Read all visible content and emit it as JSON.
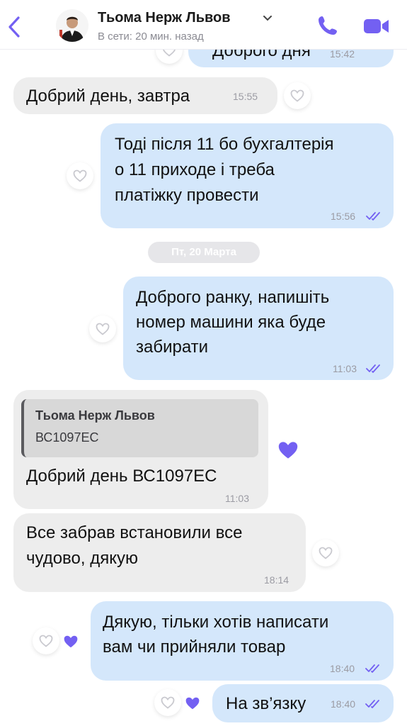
{
  "header": {
    "contact_name": "Тьома Нерж Львов",
    "status": "В сети: 20 мин. назад",
    "back_icon": "chevron-left-icon",
    "call_icon": "phone-icon",
    "video_icon": "video-camera-icon",
    "accent_color": "#7360f2"
  },
  "messages": [
    {
      "id": "m0",
      "direction": "out",
      "text": "Доброго дня",
      "time": "15:42",
      "partial": true
    },
    {
      "id": "m1",
      "direction": "in",
      "text": "Добрий день, завтра",
      "time": "15:55"
    },
    {
      "id": "m2",
      "direction": "out",
      "lines": [
        "Тоді після 11 бо бухгалтерія",
        "о 11 приходе і треба",
        "платіжку провести"
      ],
      "time": "15:56"
    },
    {
      "id": "m3",
      "direction": "out",
      "lines": [
        "Доброго ранку, напишіть",
        "номер машини яка буде",
        "забирати"
      ],
      "time": "11:03"
    },
    {
      "id": "m4",
      "direction": "in",
      "quote_author": "Тьома Нерж Львов",
      "quote_text": "ВС1097ЕС",
      "text": "Добрий день ВС1097ЕС",
      "time": "11:03",
      "liked": true
    },
    {
      "id": "m5",
      "direction": "in",
      "lines": [
        "Все забрав встановили все",
        "чудово, дякую"
      ],
      "time": "18:14"
    },
    {
      "id": "m6",
      "direction": "out",
      "lines": [
        "Дякую, тільки хотів написати",
        "вам чи прийняли товар"
      ],
      "time": "18:40",
      "liked": true
    },
    {
      "id": "m7",
      "direction": "out",
      "text": "На зв’язку",
      "time": "18:40",
      "liked": true
    }
  ],
  "date_separator": "Пт, 20 Марта",
  "colors": {
    "incoming_bubble": "#ededed",
    "outgoing_bubble": "#d4e7fb",
    "like_heart": "#7360f2"
  }
}
